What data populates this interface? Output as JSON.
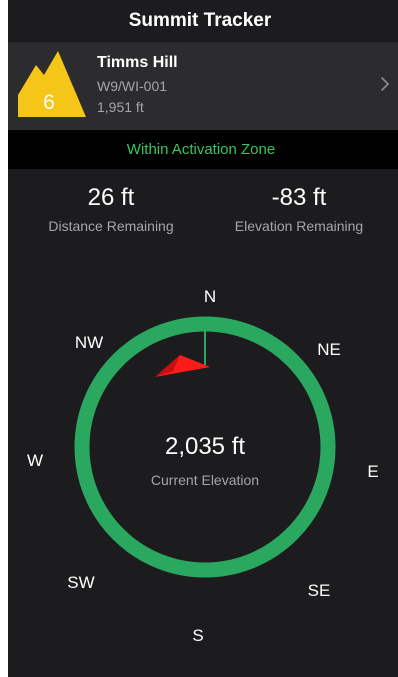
{
  "header": {
    "title": "Summit Tracker"
  },
  "summit": {
    "badge_number": "6",
    "name": "Timms Hill",
    "reference": "W9/WI-001",
    "altitude": "1,951 ft"
  },
  "status": {
    "zone_text": "Within Activation Zone"
  },
  "stats": {
    "distance_value": "26 ft",
    "distance_label": "Distance Remaining",
    "elevation_value": "-83 ft",
    "elevation_label": "Elevation Remaining"
  },
  "compass": {
    "directions": {
      "n": "N",
      "ne": "NE",
      "e": "E",
      "se": "SE",
      "s": "S",
      "sw": "SW",
      "w": "W",
      "nw": "NW"
    },
    "current_elevation_value": "2,035 ft",
    "current_elevation_label": "Current Elevation"
  },
  "colors": {
    "ring": "#2aa860",
    "needle": "#ff1a1a",
    "badge": "#f5c518",
    "zone_text": "#34c759"
  }
}
